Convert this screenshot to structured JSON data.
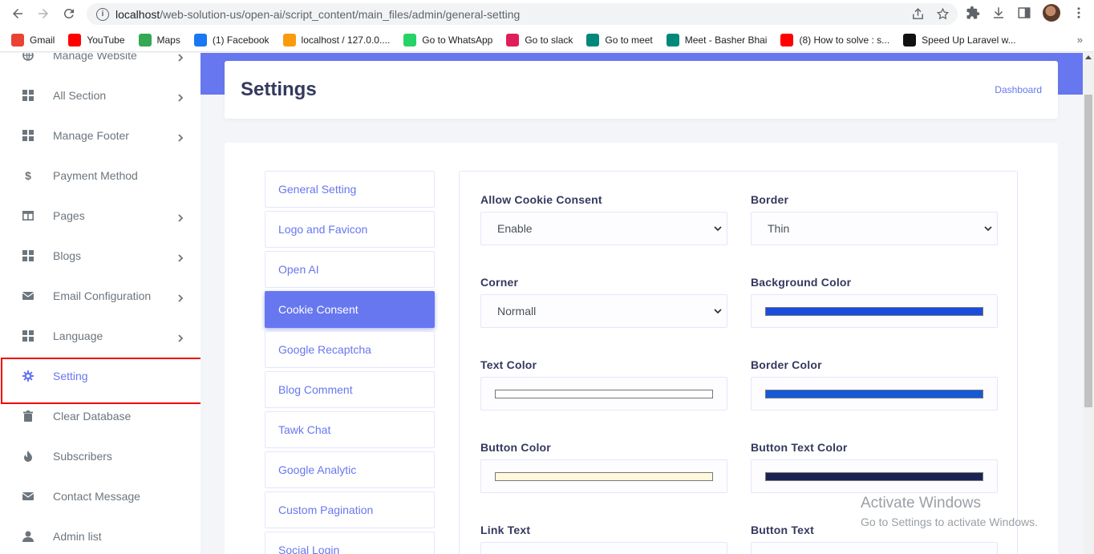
{
  "browser": {
    "url_host": "localhost",
    "url_path": "/web-solution-us/open-ai/script_content/main_files/admin/general-setting",
    "bookmarks": [
      {
        "label": "Gmail",
        "icon": "gmail-icon",
        "color": "#ea4335"
      },
      {
        "label": "YouTube",
        "icon": "youtube-icon",
        "color": "#ff0000"
      },
      {
        "label": "Maps",
        "icon": "maps-icon",
        "color": "#34a853"
      },
      {
        "label": "(1) Facebook",
        "icon": "facebook-icon",
        "color": "#1877f2"
      },
      {
        "label": "localhost / 127.0.0....",
        "icon": "phpmyadmin-icon",
        "color": "#f89c0e"
      },
      {
        "label": "Go to WhatsApp",
        "icon": "whatsapp-icon",
        "color": "#25d366"
      },
      {
        "label": "Go to slack",
        "icon": "slack-icon",
        "color": "#e01e5a"
      },
      {
        "label": "Go to meet",
        "icon": "meet-icon",
        "color": "#00897b"
      },
      {
        "label": "Meet - Basher Bhai",
        "icon": "meet-icon",
        "color": "#00897b"
      },
      {
        "label": "(8) How to solve : s...",
        "icon": "youtube-icon",
        "color": "#ff0000"
      },
      {
        "label": "Speed Up Laravel w...",
        "icon": "laravel-icon",
        "color": "#111111"
      }
    ],
    "more": "»"
  },
  "sidebar": {
    "items": [
      {
        "label": "Manage Website",
        "icon": "globe-icon",
        "chevron": true
      },
      {
        "label": "All Section",
        "icon": "grid-icon",
        "chevron": true
      },
      {
        "label": "Manage Footer",
        "icon": "grid-icon",
        "chevron": true
      },
      {
        "label": "Payment Method",
        "icon": "dollar-icon",
        "chevron": false
      },
      {
        "label": "Pages",
        "icon": "columns-icon",
        "chevron": true
      },
      {
        "label": "Blogs",
        "icon": "grid-icon",
        "chevron": true
      },
      {
        "label": "Email Configuration",
        "icon": "envelope-icon",
        "chevron": true
      },
      {
        "label": "Language",
        "icon": "grid-icon",
        "chevron": true
      },
      {
        "label": "Setting",
        "icon": "gear-icon",
        "chevron": false,
        "active": true
      },
      {
        "label": "Clear Database",
        "icon": "trash-icon",
        "chevron": false
      },
      {
        "label": "Subscribers",
        "icon": "fire-icon",
        "chevron": false
      },
      {
        "label": "Contact Message",
        "icon": "envelope-icon",
        "chevron": false
      },
      {
        "label": "Admin list",
        "icon": "user-icon",
        "chevron": false
      }
    ]
  },
  "header": {
    "title": "Settings",
    "breadcrumb": "Dashboard"
  },
  "tabs": [
    {
      "label": "General Setting"
    },
    {
      "label": "Logo and Favicon"
    },
    {
      "label": "Open AI"
    },
    {
      "label": "Cookie Consent",
      "active": true
    },
    {
      "label": "Google Recaptcha"
    },
    {
      "label": "Blog Comment"
    },
    {
      "label": "Tawk Chat"
    },
    {
      "label": "Google Analytic"
    },
    {
      "label": "Custom Pagination"
    },
    {
      "label": "Social Login"
    }
  ],
  "form": {
    "allow_cookie": {
      "label": "Allow Cookie Consent",
      "value": "Enable"
    },
    "border": {
      "label": "Border",
      "value": "Thin"
    },
    "corner": {
      "label": "Corner",
      "value": "Normall"
    },
    "background_color": {
      "label": "Background Color",
      "color": "#1a4ddb"
    },
    "text_color": {
      "label": "Text Color",
      "color": "#ffffff"
    },
    "border_color": {
      "label": "Border Color",
      "color": "#1559d6"
    },
    "button_color": {
      "label": "Button Color",
      "color": "#fff8dc"
    },
    "button_text_color": {
      "label": "Button Text Color",
      "color": "#1c2353"
    },
    "link_text": {
      "label": "Link Text"
    },
    "button_text": {
      "label": "Button Text"
    }
  },
  "watermark": {
    "line1": "Activate Windows",
    "line2": "Go to Settings to activate Windows."
  }
}
